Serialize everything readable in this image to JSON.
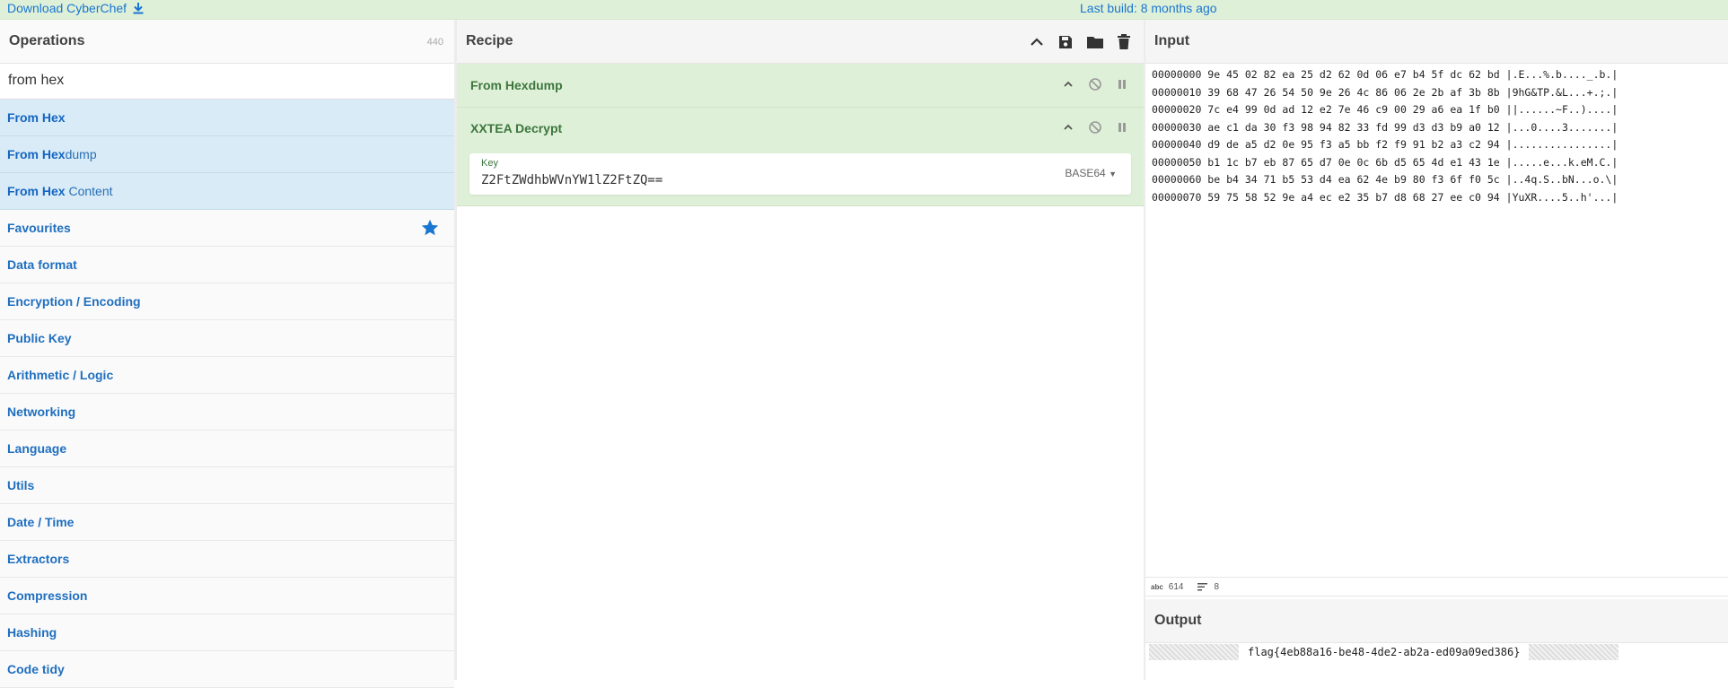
{
  "banner": {
    "download_label": "Download CyberChef",
    "download_icon": "download-icon",
    "last_build": "Last build: 8 months ago"
  },
  "operations": {
    "title": "Operations",
    "count": "440",
    "search_value": "from hex",
    "results": [
      {
        "match": "From Hex",
        "rest": ""
      },
      {
        "match": "From Hex",
        "rest": "dump"
      },
      {
        "match": "From Hex",
        "rest": " Content"
      }
    ],
    "categories": [
      "Favourites",
      "Data format",
      "Encryption / Encoding",
      "Public Key",
      "Arithmetic / Logic",
      "Networking",
      "Language",
      "Utils",
      "Date / Time",
      "Extractors",
      "Compression",
      "Hashing",
      "Code tidy"
    ]
  },
  "recipe": {
    "title": "Recipe",
    "ops": [
      {
        "name": "From Hexdump"
      },
      {
        "name": "XXTEA Decrypt",
        "arg_label": "Key",
        "arg_value": "Z2FtZWdhbWVnYW1lZ2FtZQ==",
        "arg_encoding": "BASE64"
      }
    ]
  },
  "input": {
    "title": "Input",
    "lines": [
      "00000000 9e 45 02 82 ea 25 d2 62 0d 06 e7 b4 5f dc 62 bd |.E...%.b...._.b.|",
      "00000010 39 68 47 26 54 50 9e 26 4c 86 06 2e 2b af 3b 8b |9hG&TP.&L...+.;.|",
      "00000020 7c e4 99 0d ad 12 e2 7e 46 c9 00 29 a6 ea 1f b0 ||......~F..)....|",
      "00000030 ae c1 da 30 f3 98 94 82 33 fd 99 d3 d3 b9 a0 12 |...0....3.......|",
      "00000040 d9 de a5 d2 0e 95 f3 a5 bb f2 f9 91 b2 a3 c2 94 |................|",
      "00000050 b1 1c b7 eb 87 65 d7 0e 0c 6b d5 65 4d e1 43 1e |.....e...k.eM.C.|",
      "00000060 be b4 34 71 b5 53 d4 ea 62 4e b9 80 f3 6f f0 5c |..4q.S..bN...o.\\|",
      "00000070 59 75 58 52 9e a4 ec e2 35 b7 d8 68 27 ee c0 94 |YuXR....5..h'...|"
    ],
    "length_label": "614",
    "lines_label": "8"
  },
  "output": {
    "title": "Output",
    "value": "flag{4eb88a16-be48-4de2-ab2a-ed09a09ed386}"
  }
}
